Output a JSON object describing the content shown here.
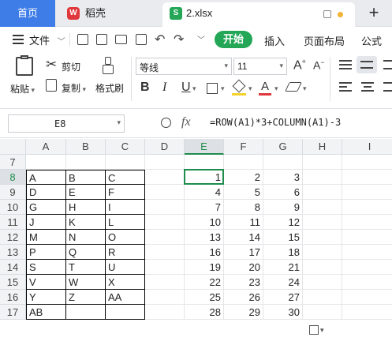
{
  "tabs": {
    "home": "首页",
    "wps": "稻壳",
    "active": "2.xlsx"
  },
  "menu": {
    "file": "文件",
    "items": [
      "开始",
      "插入",
      "页面布局",
      "公式"
    ]
  },
  "ribbon": {
    "paste": "粘贴",
    "cut": "剪切",
    "copy": "复制",
    "format_painter": "格式刷",
    "font_name": "等线",
    "font_size": "11",
    "bold": "B",
    "italic": "I",
    "underline": "U",
    "font_color_letter": "A"
  },
  "formula_bar": {
    "name_box": "E8",
    "fx": "fx",
    "formula": "=ROW(A1)*3+COLUMN(A1)-3"
  },
  "grid": {
    "columns": [
      "A",
      "B",
      "C",
      "D",
      "E",
      "F",
      "G",
      "H",
      "I"
    ],
    "rows": [
      "7",
      "8",
      "9",
      "10",
      "11",
      "12",
      "13",
      "14",
      "15",
      "16",
      "17"
    ],
    "letters": [
      [
        "A",
        "B",
        "C"
      ],
      [
        "D",
        "E",
        "F"
      ],
      [
        "G",
        "H",
        "I"
      ],
      [
        "J",
        "K",
        "L"
      ],
      [
        "M",
        "N",
        "O"
      ],
      [
        "P",
        "Q",
        "R"
      ],
      [
        "S",
        "T",
        "U"
      ],
      [
        "V",
        "W",
        "X"
      ],
      [
        "Y",
        "Z",
        "AA"
      ],
      [
        "AB",
        "",
        ""
      ]
    ],
    "numbers": [
      [
        "1",
        "2",
        "3"
      ],
      [
        "4",
        "5",
        "6"
      ],
      [
        "7",
        "8",
        "9"
      ],
      [
        "10",
        "11",
        "12"
      ],
      [
        "13",
        "14",
        "15"
      ],
      [
        "16",
        "17",
        "18"
      ],
      [
        "19",
        "20",
        "21"
      ],
      [
        "22",
        "23",
        "24"
      ],
      [
        "25",
        "26",
        "27"
      ],
      [
        "28",
        "29",
        "30"
      ]
    ]
  },
  "colors": {
    "accent": "#3e7ce8",
    "start_tab": "#23a757",
    "selection": "#1f8c4e"
  }
}
